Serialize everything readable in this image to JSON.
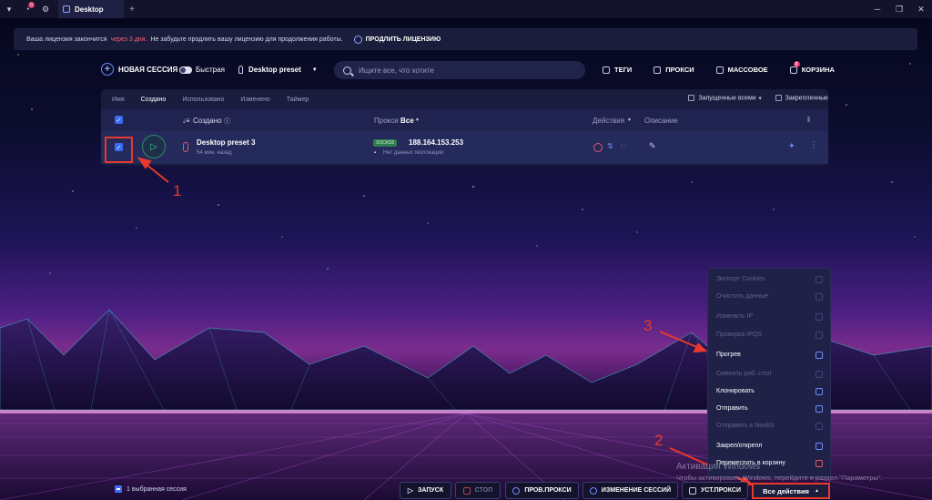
{
  "titlebar": {
    "notification_count": "0",
    "tab_title": "Desktop",
    "add_tab": "+"
  },
  "banner": {
    "text_before": "Ваша лицензия закончится",
    "text_warning": "через 3 дня.",
    "text_after": "Не забудьте продлить вашу лицензию для продолжения работы.",
    "renew_label": "ПРОДЛИТЬ ЛИЦЕНЗИЮ"
  },
  "toolbar": {
    "new_session": "НОВАЯ СЕССИЯ",
    "quick": "Быстрая",
    "preset": "Desktop preset",
    "search_placeholder": "Ищите все, что хотите",
    "tags": "ТЕГИ",
    "proxies": "ПРОКСИ",
    "bulk": "МАССОВОЕ",
    "trash": "КОРЗИНА",
    "trash_count": "0"
  },
  "filters": {
    "items": [
      "Имя",
      "Создано",
      "Использовано",
      "Изменено",
      "Таймер"
    ],
    "launched_all": "Запущенные всеми",
    "pinned": "Закрепленные"
  },
  "table": {
    "col_created": "Создано",
    "col_proxy": "Прокси",
    "col_proxy_filter": "Все",
    "col_actions": "Действия",
    "col_description": "Описание"
  },
  "session": {
    "name": "Desktop preset 3",
    "created_ago": "54 мин. назад",
    "proxy_type": "SOCKS5",
    "proxy_ip": "188.164.153.253",
    "geo": "Нет данных геолокации"
  },
  "annotations": [
    "1",
    "2",
    "3"
  ],
  "menu": {
    "items": [
      {
        "label": "Экспорт Cookies",
        "enabled": false
      },
      {
        "label": "Очистить данные",
        "enabled": false
      },
      {
        "label": "Изменить IP",
        "enabled": false
      },
      {
        "label": "Проверка IPQS",
        "enabled": false
      },
      {
        "label": "Прогрев",
        "enabled": true
      },
      {
        "label": "Сменить раб. стол",
        "enabled": false
      },
      {
        "label": "Клонировать",
        "enabled": true
      },
      {
        "label": "Отправить",
        "enabled": true
      },
      {
        "label": "Отправить в Nooklz",
        "enabled": false
      },
      {
        "label": "Закреп/открепл",
        "enabled": true
      },
      {
        "label": "Переместить в корзину",
        "enabled": true
      }
    ]
  },
  "watermark": {
    "title": "Активация Windows",
    "text": "Чтобы активировать Windows, перейдите в раздел \"Параметры\"."
  },
  "bottom": {
    "selected": "1 выбранная сессия",
    "start": "ЗАПУСК",
    "stop": "СТОП",
    "check_proxy": "ПРОВ.ПРОКСИ",
    "change_sessions": "ИЗМЕНЕНИЕ СЕССИЙ",
    "set_proxy": "УСТ.ПРОКСИ",
    "all_actions": "Все действия"
  },
  "colors": {
    "accent": "#3b6cf6",
    "highlight": "#e8392b",
    "warning": "#ff5d6e"
  }
}
